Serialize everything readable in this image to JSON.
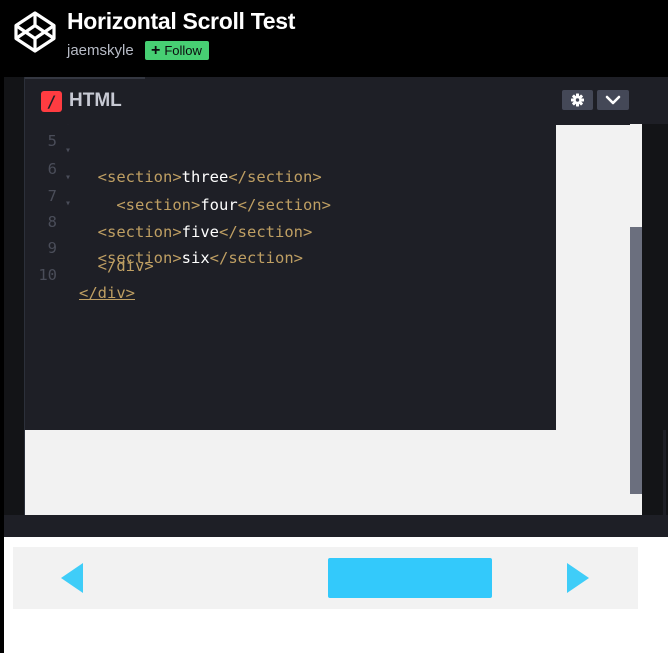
{
  "header": {
    "title": "Horizontal Scroll Test",
    "author": "jaemskyle",
    "follow_label": "Follow",
    "follow_icon": "plus-icon",
    "logo_icon": "codepen-logo-icon"
  },
  "editor": {
    "tab_label": "HTML",
    "tab_icon": "html-slash-icon",
    "settings_icon": "gear-icon",
    "collapse_icon": "chevron-down-icon",
    "lines": [
      {
        "num": "5",
        "fold": "▾",
        "indent": "  ",
        "open": "<section>",
        "text": "three",
        "close": "</section>"
      },
      {
        "num": "6",
        "fold": "▾",
        "indent": "    ",
        "open": "<section>",
        "text": "four",
        "close": "</section>"
      },
      {
        "num": "7",
        "fold": "▾",
        "indent": "  ",
        "open": "<section>",
        "text": "five",
        "close": "</section>"
      },
      {
        "num": "8",
        "fold": "▾",
        "indent": "  ",
        "open": "<section>",
        "text": "six",
        "close": "</section>"
      },
      {
        "num": "9",
        "fold": "",
        "indent": "  ",
        "open": "</div>",
        "text": "",
        "close": ""
      },
      {
        "num": "10",
        "fold": "",
        "indent": "",
        "open": "</div>",
        "text": "",
        "close": ""
      }
    ]
  },
  "colors": {
    "tag": "#bf9f63",
    "accent_nav": "#3fcdf8",
    "follow_bg": "#47cf73",
    "html_icon": "#ff3c41"
  },
  "result": {
    "prev_icon": "arrow-left-icon",
    "next_icon": "arrow-right-icon"
  }
}
